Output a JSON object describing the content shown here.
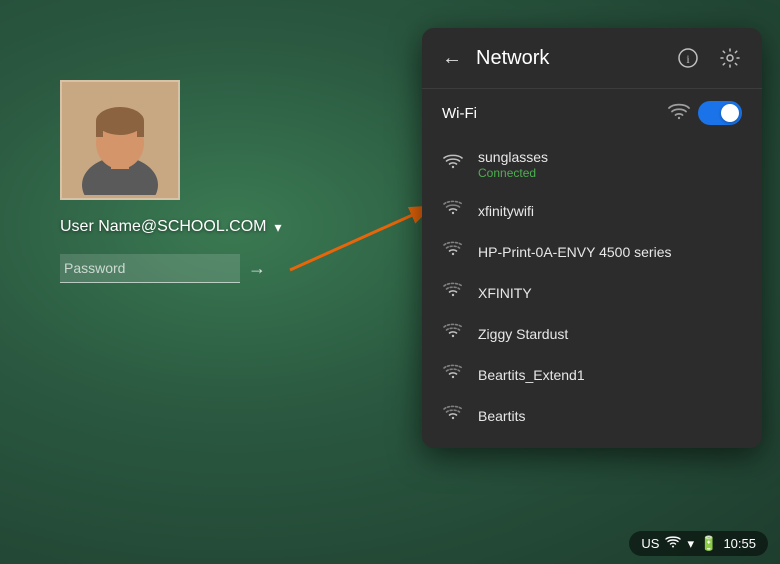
{
  "background": {
    "color": "#2a5840"
  },
  "login": {
    "username": "User Name@SCHOOL.COM",
    "password_placeholder": "Password",
    "dropdown_symbol": "▾",
    "submit_arrow": "→"
  },
  "network_panel": {
    "title": "Network",
    "back_button": "←",
    "info_icon": "ℹ",
    "settings_icon": "⚙",
    "wifi_section_label": "Wi-Fi",
    "wifi_enabled": true,
    "networks": [
      {
        "name": "sunglasses",
        "status": "Connected",
        "signal": 4,
        "connected": true
      },
      {
        "name": "xfinitywifi",
        "status": "",
        "signal": 3,
        "connected": false
      },
      {
        "name": "HP-Print-0A-ENVY 4500 series",
        "status": "",
        "signal": 2,
        "connected": false
      },
      {
        "name": "XFINITY",
        "status": "",
        "signal": 2,
        "connected": false
      },
      {
        "name": "Ziggy Stardust",
        "status": "",
        "signal": 2,
        "connected": false
      },
      {
        "name": "Beartits_Extend1",
        "status": "",
        "signal": 2,
        "connected": false
      },
      {
        "name": "Beartits",
        "status": "",
        "signal": 2,
        "connected": false
      }
    ]
  },
  "taskbar": {
    "region": "US",
    "time": "10:55",
    "wifi_icon": "▾",
    "battery_icon": "🔋"
  }
}
